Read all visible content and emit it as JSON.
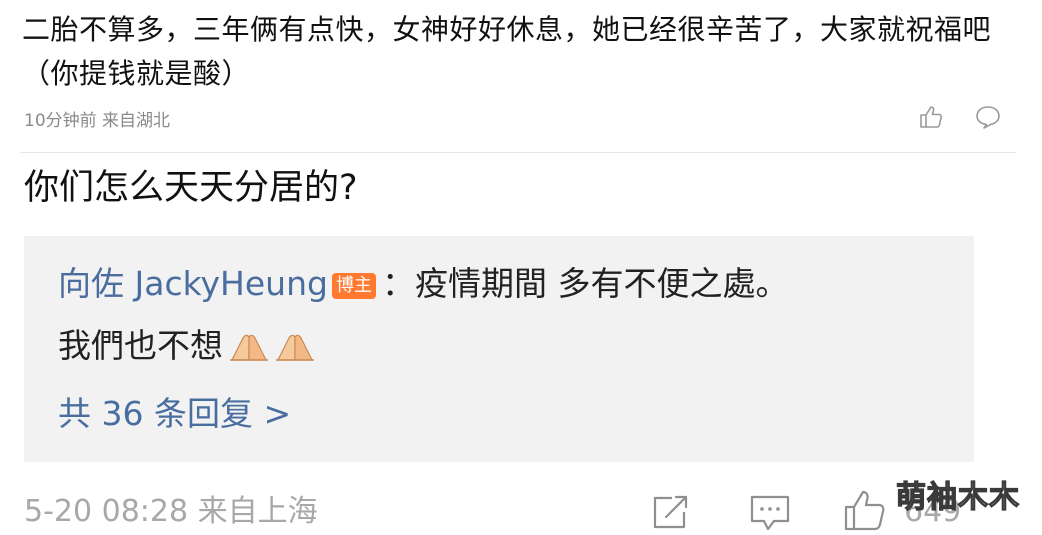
{
  "comment1": {
    "text": "二胎不算多，三年俩有点快，女神好好休息，她已经很辛苦了，大家就祝福吧（你提钱就是酸）",
    "meta": "10分钟前 来自湖北",
    "like_icon": "thumbs-up-icon",
    "reply_icon": "speech-bubble-icon"
  },
  "comment2": {
    "text": "你们怎么天天分居的?",
    "reply": {
      "author": "向佐 JackyHeung",
      "badge": "博主",
      "separator": "：",
      "text_part1": "疫情期間 多有不便之處。",
      "text_part2": "我們也不想",
      "emoji": "folded-hands-emoji",
      "count_label": "共 36 条回复 >"
    },
    "meta": "5-20 08:28 来自上海",
    "share_icon": "share-icon",
    "comment_icon": "comment-icon",
    "like_icon": "thumbs-up-icon",
    "like_count": "649"
  },
  "watermark": "萌袖木木",
  "colors": {
    "link_blue": "#4a6da0",
    "badge_orange": "#ff7a2e",
    "meta_gray": "#a8a8a8",
    "reply_bg": "#f2f2f2"
  }
}
